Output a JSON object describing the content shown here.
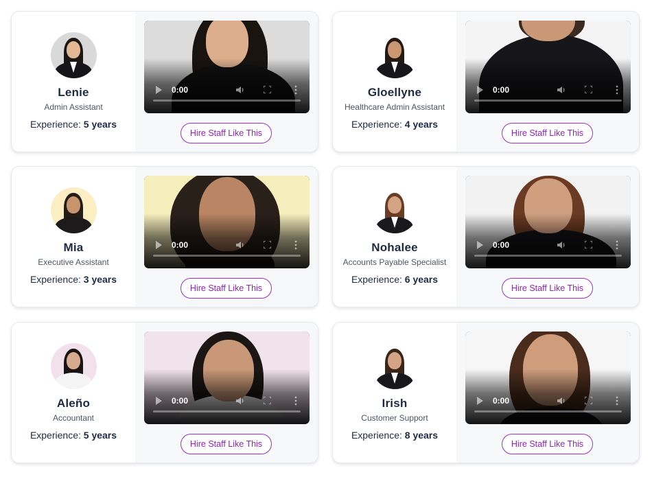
{
  "cards": [
    {
      "name": "Lenie",
      "role": "Admin Assistant",
      "experience_label": "Experience:",
      "experience_value": "5 years",
      "video_time": "0:00",
      "hire_label": "Hire Staff Like This",
      "avatar_colors": {
        "bg": "#d9d9d9",
        "hair": "#1c1612",
        "skin": "#e2b896",
        "body": "#15151a"
      },
      "video_colors": {
        "bg": "#dcdcdc",
        "hair": "#1a1410",
        "skin": "#dcae8c",
        "body": "#111111"
      }
    },
    {
      "name": "Gloellyne",
      "role": "Healthcare Admin Assistant",
      "experience_label": "Experience:",
      "experience_value": "4 years",
      "video_time": "0:00",
      "hire_label": "Hire Staff Like This",
      "avatar_colors": {
        "bg": "#ffffff",
        "hair": "#241a14",
        "skin": "#c99872",
        "body": "#17171b"
      },
      "video_colors": {
        "bg": "#f4f4f4",
        "hair": "#3a2a20",
        "skin": "#c99876",
        "body": "#16161a"
      }
    },
    {
      "name": "Mia",
      "role": "Executive Assistant",
      "experience_label": "Experience:",
      "experience_value": "3 years",
      "video_time": "0:00",
      "hire_label": "Hire Staff Like This",
      "avatar_colors": {
        "bg": "#fbeec2",
        "hair": "#241c16",
        "skin": "#c7946e",
        "body": "#1c1a1a"
      },
      "video_colors": {
        "bg": "#f7eebd",
        "hair": "#2a201a",
        "skin": "#b98564",
        "body": "#2a201a"
      }
    },
    {
      "name": "Nohalee",
      "role": "Accounts Payable Specialist",
      "experience_label": "Experience:",
      "experience_value": "6 years",
      "video_time": "0:00",
      "hire_label": "Hire Staff Like This",
      "avatar_colors": {
        "bg": "#ffffff",
        "hair": "#6b3d24",
        "skin": "#d3a383",
        "body": "#1a1a1e"
      },
      "video_colors": {
        "bg": "#f2f2f2",
        "hair": "#6a3a22",
        "skin": "#cf9f80",
        "body": "#141418"
      }
    },
    {
      "name": "Aleño",
      "role": "Accountant",
      "experience_label": "Experience:",
      "experience_value": "5 years",
      "video_time": "0:00",
      "hire_label": "Hire Staff Like This",
      "avatar_colors": {
        "bg": "#f2e1ea",
        "hair": "#191312",
        "skin": "#d8ab8e",
        "body": "#f5f5f5"
      },
      "video_colors": {
        "bg": "#f1e3ec",
        "hair": "#1b1513",
        "skin": "#c99878",
        "body": "#f4f4f4"
      }
    },
    {
      "name": "Irish",
      "role": "Customer Support",
      "experience_label": "Experience:",
      "experience_value": "8 years",
      "video_time": "0:00",
      "hire_label": "Hire Staff Like This",
      "avatar_colors": {
        "bg": "#ffffff",
        "hair": "#3b2418",
        "skin": "#d3a585",
        "body": "#18181c"
      },
      "video_colors": {
        "bg": "#f6f6f6",
        "hair": "#4a2c1c",
        "skin": "#cf9c7c",
        "body": "#1a1a1e"
      }
    }
  ]
}
